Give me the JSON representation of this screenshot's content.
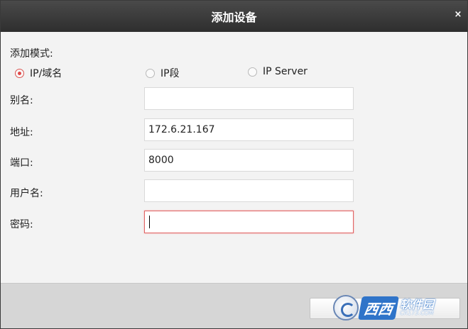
{
  "window": {
    "title": "添加设备",
    "close_glyph": "×"
  },
  "form": {
    "mode_label": "添加模式:",
    "modes": [
      {
        "label": "IP/域名",
        "checked": true
      },
      {
        "label": "IP段",
        "checked": false
      },
      {
        "label": "IP Server",
        "checked": false
      }
    ],
    "fields": [
      {
        "label": "别名:",
        "value": ""
      },
      {
        "label": "地址:",
        "value": "172.6.21.167"
      },
      {
        "label": "端口:",
        "value": "8000"
      },
      {
        "label": "用户名:",
        "value": ""
      },
      {
        "label": "密码:",
        "value": "",
        "focused": true
      }
    ]
  },
  "watermark": {
    "text": "西西",
    "sub_big": "软件园",
    "sub_small": "CR173.COM"
  },
  "colors": {
    "titlebar": "#3a3a3a",
    "radio_checked": "#e04848",
    "focus_border": "#e06464"
  }
}
